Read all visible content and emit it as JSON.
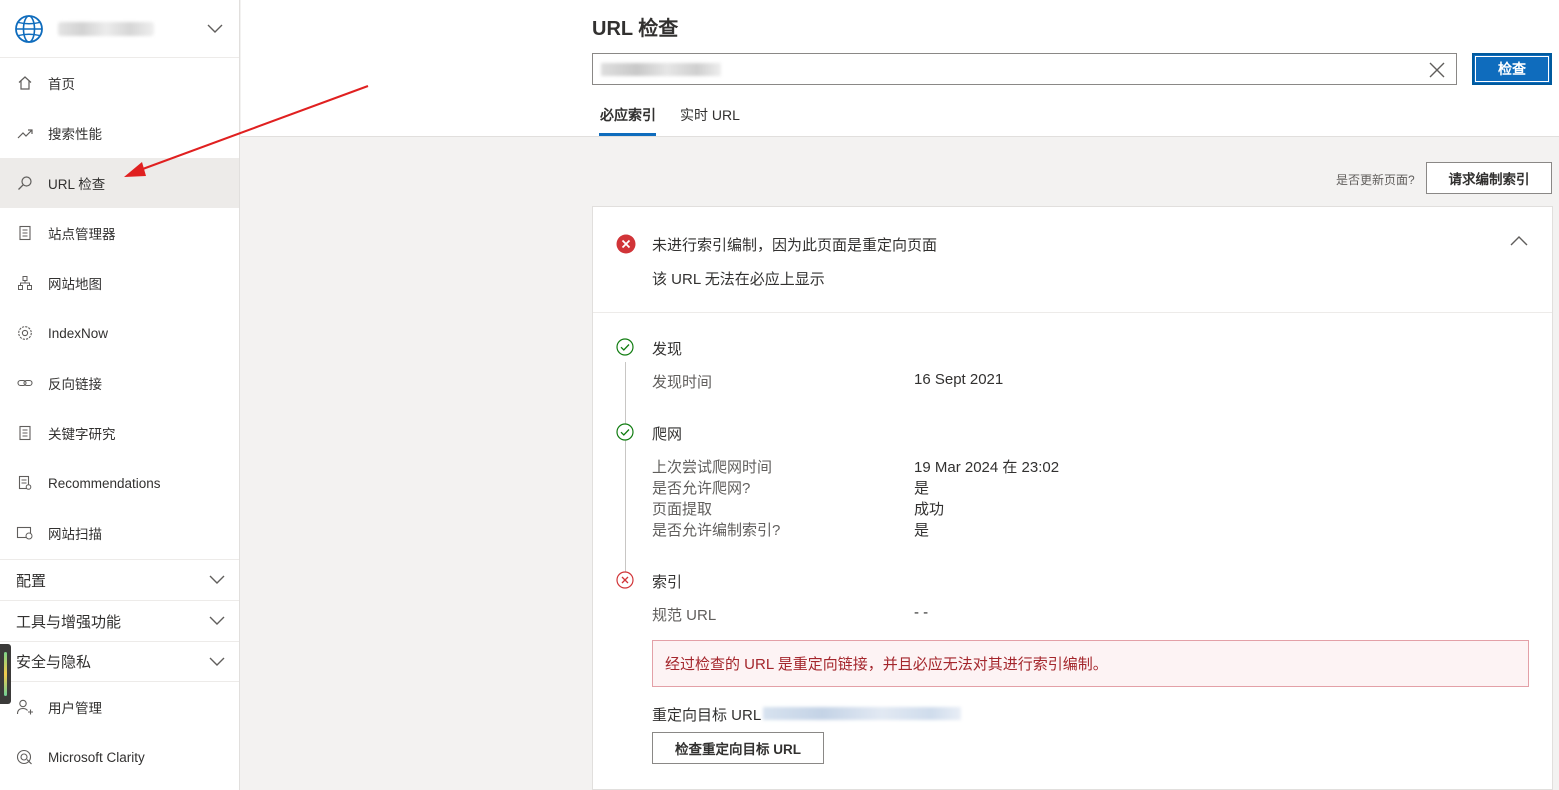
{
  "sidebar": {
    "nav": [
      {
        "label": "首页",
        "icon": "home-icon"
      },
      {
        "label": "搜索性能",
        "icon": "trend-icon"
      },
      {
        "label": "URL 检查",
        "icon": "search-icon"
      },
      {
        "label": "站点管理器",
        "icon": "document-icon"
      },
      {
        "label": "网站地图",
        "icon": "sitemap-icon"
      },
      {
        "label": "IndexNow",
        "icon": "gear-icon"
      },
      {
        "label": "反向链接",
        "icon": "link-icon"
      },
      {
        "label": "关键字研究",
        "icon": "document-icon"
      },
      {
        "label": "Recommendations",
        "icon": "report-icon"
      },
      {
        "label": "网站扫描",
        "icon": "scan-icon"
      }
    ],
    "sections": [
      "配置",
      "工具与增强功能",
      "安全与隐私"
    ],
    "bottom": [
      {
        "label": "用户管理",
        "icon": "user-icon"
      },
      {
        "label": "Microsoft Clarity",
        "icon": "clarity-icon"
      }
    ]
  },
  "header": {
    "title": "URL 检查",
    "inspect_label": "检查",
    "tabs": [
      "必应索引",
      "实时 URL"
    ]
  },
  "request": {
    "question": "是否更新页面?",
    "button": "请求编制索引"
  },
  "card": {
    "title": "未进行索引编制，因为此页面是重定向页面",
    "subtitle": "该 URL 无法在必应上显示",
    "discovery": {
      "title": "发现",
      "rows": [
        {
          "k": "发现时间",
          "v": "16 Sept 2021"
        }
      ]
    },
    "crawl": {
      "title": "爬网",
      "rows": [
        {
          "k": "上次尝试爬网时间",
          "v": "19 Mar 2024 在 23:02"
        },
        {
          "k": "是否允许爬网?",
          "v": "是"
        },
        {
          "k": "页面提取",
          "v": "成功"
        },
        {
          "k": "是否允许编制索引?",
          "v": "是"
        }
      ]
    },
    "index": {
      "title": "索引",
      "rows": [
        {
          "k": "规范 URL",
          "v": "- -"
        }
      ],
      "error": "经过检查的 URL 是重定向链接，并且必应无法对其进行索引编制。",
      "redirect_label": "重定向目标 URL",
      "redirect_button": "检查重定向目标 URL"
    }
  },
  "colors": {
    "accent": "#0f6cbd",
    "error": "#d13438",
    "success": "#107c10",
    "annotation_arrow": "#e02020"
  }
}
